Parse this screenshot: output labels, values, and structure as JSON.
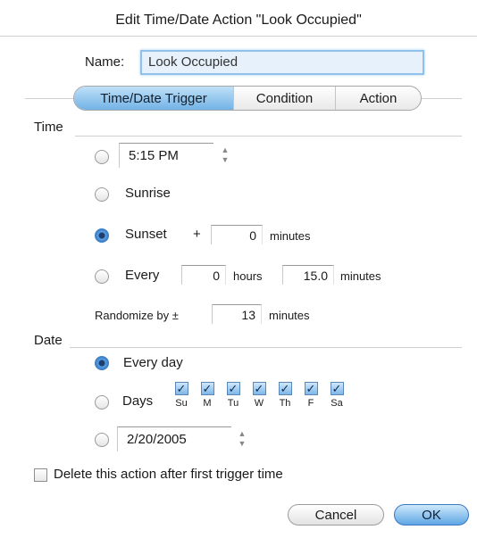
{
  "dialog": {
    "title": "Edit Time/Date Action \"Look Occupied\""
  },
  "name": {
    "label": "Name:",
    "value": "Look Occupied"
  },
  "tabs": [
    {
      "label": "Time/Date Trigger",
      "active": true
    },
    {
      "label": "Condition",
      "active": false
    },
    {
      "label": "Action",
      "active": false
    }
  ],
  "time": {
    "section_label": "Time",
    "specific_time": "5:15 PM",
    "sunrise_label": "Sunrise",
    "sunset_label": "Sunset",
    "sunset_plus": "+",
    "sunset_offset": "0",
    "minutes_label": "minutes",
    "every_label": "Every",
    "every_hours": "0",
    "hours_label": "hours",
    "every_minutes": "15.0",
    "randomize_label": "Randomize by ±",
    "randomize_value": "13",
    "selected": "sunset"
  },
  "date": {
    "section_label": "Date",
    "every_day_label": "Every day",
    "days_label": "Days",
    "days": [
      {
        "label": "Su",
        "checked": true
      },
      {
        "label": "M",
        "checked": true
      },
      {
        "label": "Tu",
        "checked": true
      },
      {
        "label": "W",
        "checked": true
      },
      {
        "label": "Th",
        "checked": true
      },
      {
        "label": "F",
        "checked": true
      },
      {
        "label": "Sa",
        "checked": true
      }
    ],
    "specific_date": "2/20/2005",
    "selected": "every_day"
  },
  "delete_after": {
    "label": "Delete this action after first trigger time",
    "checked": false
  },
  "buttons": {
    "cancel": "Cancel",
    "ok": "OK"
  },
  "colors": {
    "accent": "#6aaee6",
    "field_focus": "#8fc1ea"
  }
}
